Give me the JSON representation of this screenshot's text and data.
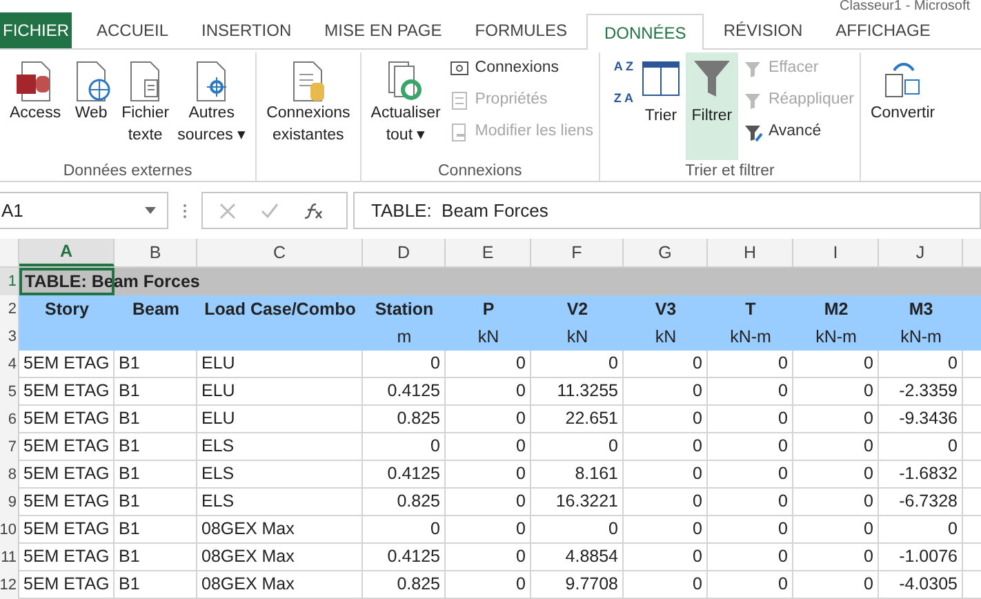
{
  "title": "Classeur1 - Microsoft",
  "tabs": [
    {
      "label": "FICHIER",
      "kind": "file",
      "selected": false
    },
    {
      "label": "ACCUEIL",
      "kind": "tab",
      "selected": false
    },
    {
      "label": "INSERTION",
      "kind": "tab",
      "selected": false
    },
    {
      "label": "MISE EN PAGE",
      "kind": "tab",
      "selected": false
    },
    {
      "label": "FORMULES",
      "kind": "tab",
      "selected": false
    },
    {
      "label": "DONNÉES",
      "kind": "tab",
      "selected": true
    },
    {
      "label": "RÉVISION",
      "kind": "tab",
      "selected": false
    },
    {
      "label": "AFFICHAGE",
      "kind": "tab",
      "selected": false
    }
  ],
  "ribbon": {
    "external": {
      "label": "Données externes",
      "buttons": [
        {
          "lines": [
            "Access"
          ]
        },
        {
          "lines": [
            "Web"
          ]
        },
        {
          "lines": [
            "Fichier",
            "texte"
          ]
        },
        {
          "lines": [
            "Autres",
            "sources ▾"
          ]
        }
      ]
    },
    "existing": {
      "lines": [
        "Connexions",
        "existantes"
      ]
    },
    "connections": {
      "label": "Connexions",
      "refresh": {
        "lines": [
          "Actualiser",
          "tout ▾"
        ]
      },
      "items": [
        {
          "label": "Connexions",
          "disabled": false
        },
        {
          "label": "Propriétés",
          "disabled": true
        },
        {
          "label": "Modifier les liens",
          "disabled": true
        }
      ]
    },
    "sort_filter": {
      "label": "Trier et filtrer",
      "sort_az": "A Z",
      "sort_za": "Z A",
      "sort": "Trier",
      "filter": {
        "label": "Filtrer",
        "selected": true
      },
      "items": [
        {
          "label": "Effacer",
          "disabled": true
        },
        {
          "label": "Réappliquer",
          "disabled": true
        },
        {
          "label": "Avancé",
          "disabled": false
        }
      ]
    },
    "convert": "Convertir"
  },
  "formula_bar": {
    "name_box": "A1",
    "formula": "TABLE:  Beam Forces"
  },
  "columns": [
    {
      "label": "A",
      "selected": true
    },
    {
      "label": "B",
      "selected": false
    },
    {
      "label": "C",
      "selected": false
    },
    {
      "label": "D",
      "selected": false
    },
    {
      "label": "E",
      "selected": false
    },
    {
      "label": "F",
      "selected": false
    },
    {
      "label": "G",
      "selected": false
    },
    {
      "label": "H",
      "selected": false
    },
    {
      "label": "I",
      "selected": false
    },
    {
      "label": "J",
      "selected": false
    }
  ],
  "rows": [
    {
      "number": "1",
      "kind": "title",
      "selected": true,
      "cells": [
        "TABLE:  Beam Forces"
      ]
    },
    {
      "number": "2",
      "kind": "header",
      "selected": false,
      "cells": [
        "Story",
        "Beam",
        "Load Case/Combo",
        "Station",
        "P",
        "V2",
        "V3",
        "T",
        "M2",
        "M3"
      ]
    },
    {
      "number": "3",
      "kind": "units",
      "selected": false,
      "cells": [
        "m",
        "kN",
        "kN",
        "kN",
        "kN-m",
        "kN-m",
        "kN-m"
      ]
    },
    {
      "number": "4",
      "kind": "data",
      "selected": false,
      "cells": [
        "5EM ETAG",
        "B1",
        "ELU",
        "0",
        "0",
        "0",
        "0",
        "0",
        "0",
        "0"
      ]
    },
    {
      "number": "5",
      "kind": "data",
      "selected": false,
      "cells": [
        "5EM ETAG",
        "B1",
        "ELU",
        "0.4125",
        "0",
        "11.3255",
        "0",
        "0",
        "0",
        "-2.3359"
      ]
    },
    {
      "number": "6",
      "kind": "data",
      "selected": false,
      "cells": [
        "5EM ETAG",
        "B1",
        "ELU",
        "0.825",
        "0",
        "22.651",
        "0",
        "0",
        "0",
        "-9.3436"
      ]
    },
    {
      "number": "7",
      "kind": "data",
      "selected": false,
      "cells": [
        "5EM ETAG",
        "B1",
        "ELS",
        "0",
        "0",
        "0",
        "0",
        "0",
        "0",
        "0"
      ]
    },
    {
      "number": "8",
      "kind": "data",
      "selected": false,
      "cells": [
        "5EM ETAG",
        "B1",
        "ELS",
        "0.4125",
        "0",
        "8.161",
        "0",
        "0",
        "0",
        "-1.6832"
      ]
    },
    {
      "number": "9",
      "kind": "data",
      "selected": false,
      "cells": [
        "5EM ETAG",
        "B1",
        "ELS",
        "0.825",
        "0",
        "16.3221",
        "0",
        "0",
        "0",
        "-6.7328"
      ]
    },
    {
      "number": "10",
      "kind": "data",
      "selected": false,
      "cells": [
        "5EM ETAG",
        "B1",
        "08GEX Max",
        "0",
        "0",
        "0",
        "0",
        "0",
        "0",
        "0"
      ]
    },
    {
      "number": "11",
      "kind": "data",
      "selected": false,
      "cells": [
        "5EM ETAG",
        "B1",
        "08GEX Max",
        "0.4125",
        "0",
        "4.8854",
        "0",
        "0",
        "0",
        "-1.0076"
      ]
    },
    {
      "number": "12",
      "kind": "data",
      "selected": false,
      "cells": [
        "5EM ETAG",
        "B1",
        "08GEX Max",
        "0.825",
        "0",
        "9.7708",
        "0",
        "0",
        "0",
        "-4.0305"
      ]
    }
  ]
}
